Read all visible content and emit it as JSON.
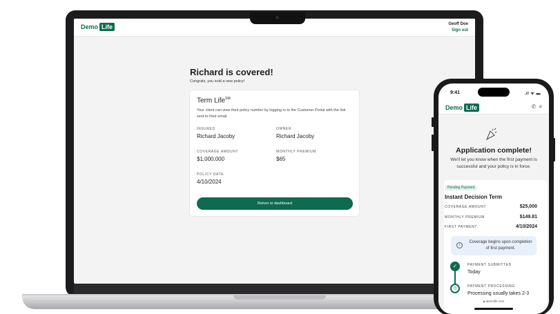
{
  "brand": {
    "name_a": "Demo",
    "name_b": "Life",
    "accent": "#0e6b4f"
  },
  "laptop": {
    "user": {
      "name": "Geoff Doe",
      "sign_out": "Sign out"
    },
    "heading": "Richard is covered!",
    "subheading": "Congrats, you sold a new policy!",
    "card": {
      "title": "Term Life",
      "title_mark": "SM",
      "description": "Your client can view their policy number by logging in to the Customer Portal with the link sent to their email.",
      "fields": {
        "insured_label": "INSURED",
        "insured_value": "Richard Jacoby",
        "owner_label": "OWNER",
        "owner_value": "Richard Jacoby",
        "coverage_label": "COVERAGE AMOUNT",
        "coverage_value": "$1,000,000",
        "premium_label": "MONTHLY PREMIUM",
        "premium_value": "$65",
        "date_label": "POLICY DATE",
        "date_value": "4/10/2024"
      },
      "button": "Return to dashboard"
    }
  },
  "phone": {
    "time": "9:41",
    "status": ".ıl ᯤ ▬",
    "icons": {
      "phone": "phone-icon",
      "menu": "menu-icon",
      "confetti": "confetti-icon",
      "info": "info-icon",
      "check": "check-icon",
      "clock": "clock-icon",
      "lock": "lock-icon"
    },
    "title": "Application complete!",
    "subtitle": "We'll let you know when the first payment is successful and your policy is in force.",
    "badge": "Pending Payment",
    "plan": "Instant Decision Term",
    "rows": [
      {
        "label": "COVERAGE AMOUNT",
        "value": "$25,000"
      },
      {
        "label": "MONTHLY PREMIUM",
        "value": "$149.81"
      },
      {
        "label": "FIRST PAYMENT",
        "value": "4/10/2024"
      }
    ],
    "info": "Coverage begins upon completion of first payment.",
    "steps": [
      {
        "label": "PAYMENT SUBMITTED",
        "value": "Today"
      },
      {
        "label": "PAYMENT PROCESSING",
        "value": "Processing usually takes 2-3"
      }
    ],
    "url": "demolife.com"
  }
}
